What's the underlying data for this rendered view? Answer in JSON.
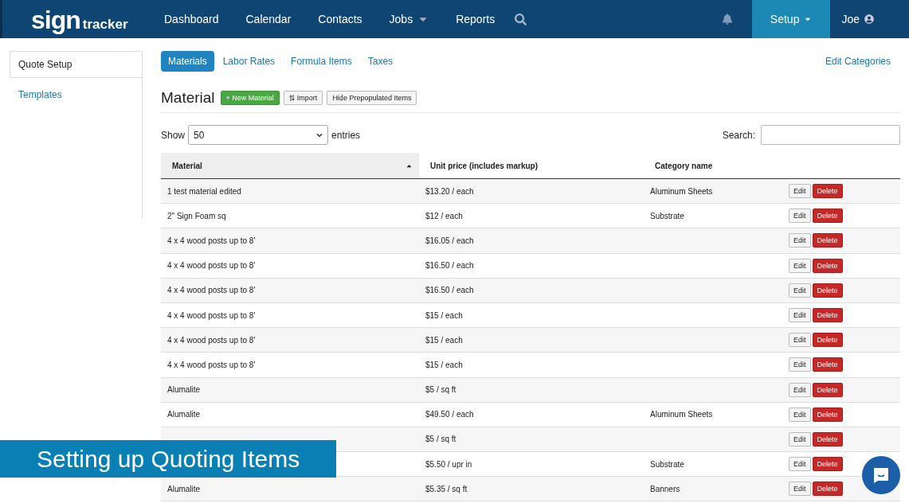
{
  "navbar": {
    "logo": {
      "main": "sign",
      "sub": "tracker"
    },
    "items": [
      {
        "label": "Dashboard",
        "dropdown": false,
        "selected": false
      },
      {
        "label": "Calendar",
        "dropdown": false,
        "selected": false
      },
      {
        "label": "Contacts",
        "dropdown": false,
        "selected": false
      },
      {
        "label": "Jobs",
        "dropdown": true,
        "selected": false
      },
      {
        "label": "Reports",
        "dropdown": false,
        "selected": false
      }
    ],
    "setup": {
      "label": "Setup",
      "selected": true
    },
    "user": {
      "label": "Joe"
    }
  },
  "sidebar": {
    "items": [
      {
        "label": "Quote Setup",
        "selected": true
      },
      {
        "label": "Templates",
        "selected": false
      }
    ]
  },
  "tabs": [
    {
      "label": "Materials",
      "selected": true
    },
    {
      "label": "Labor Rates",
      "selected": false
    },
    {
      "label": "Formula Items",
      "selected": false
    },
    {
      "label": "Taxes",
      "selected": false
    }
  ],
  "edit_categories": "Edit Categories",
  "heading": "Material",
  "actions": [
    {
      "kind": "primary",
      "label": "+ New Material"
    },
    {
      "kind": "import",
      "label": "Import"
    },
    {
      "kind": "plain",
      "label": "Hide Prepopulated Items"
    }
  ],
  "show": {
    "label": "Show",
    "value": "50",
    "suffix": "entries"
  },
  "search": {
    "label": "Search:"
  },
  "table": {
    "columns": [
      "Material",
      "Unit price (includes markup)",
      "Category name"
    ],
    "rows": [
      {
        "material": "1 test material edited",
        "price": "$13.20 / each",
        "category": "Aluminum Sheets",
        "edit": "Edit",
        "delete": "Delete"
      },
      {
        "material": "2\" Sign Foam sq",
        "price": "$12 / each",
        "category": "Substrate",
        "edit": "Edit",
        "delete": "Delete"
      },
      {
        "material": "4 x 4 wood posts up to 8'",
        "price": "$16.05 / each",
        "edit": "Edit",
        "delete": "Delete"
      },
      {
        "material": "4 x 4 wood posts up to 8'",
        "price": "$16.50 / each",
        "edit": "Edit",
        "delete": "Delete"
      },
      {
        "material": "4 x 4 wood posts up to 8'",
        "price": "$16.50 / each",
        "edit": "Edit",
        "delete": "Delete"
      },
      {
        "material": "4 x 4 wood posts up to 8'",
        "price": "$15 / each",
        "edit": "Edit",
        "delete": "Delete"
      },
      {
        "material": "4 x 4 wood posts up to 8'",
        "price": "$15 / each",
        "edit": "Edit",
        "delete": "Delete"
      },
      {
        "material": "4 x 4 wood posts up to 8'",
        "price": "$15 / each",
        "edit": "Edit",
        "delete": "Delete"
      },
      {
        "material": "Alumalite",
        "price": "$5 / sq ft",
        "edit": "Edit",
        "delete": "Delete"
      },
      {
        "material": "Alumalite",
        "price": "$49.50 / each",
        "category": "Aluminum Sheets",
        "edit": "Edit",
        "delete": "Delete"
      },
      {
        "price": "$5 / sq ft",
        "edit": "Edit",
        "delete": "Delete"
      },
      {
        "price": "$5.50 / upr in",
        "category": "Substrate",
        "edit": "Edit",
        "delete": "Delete"
      },
      {
        "material": "Alumalite",
        "price": "$5.35 / sq ft",
        "category": "Banners",
        "edit": "Edit",
        "delete": "Delete"
      }
    ]
  },
  "video_caption": "Setting up Quoting Items"
}
